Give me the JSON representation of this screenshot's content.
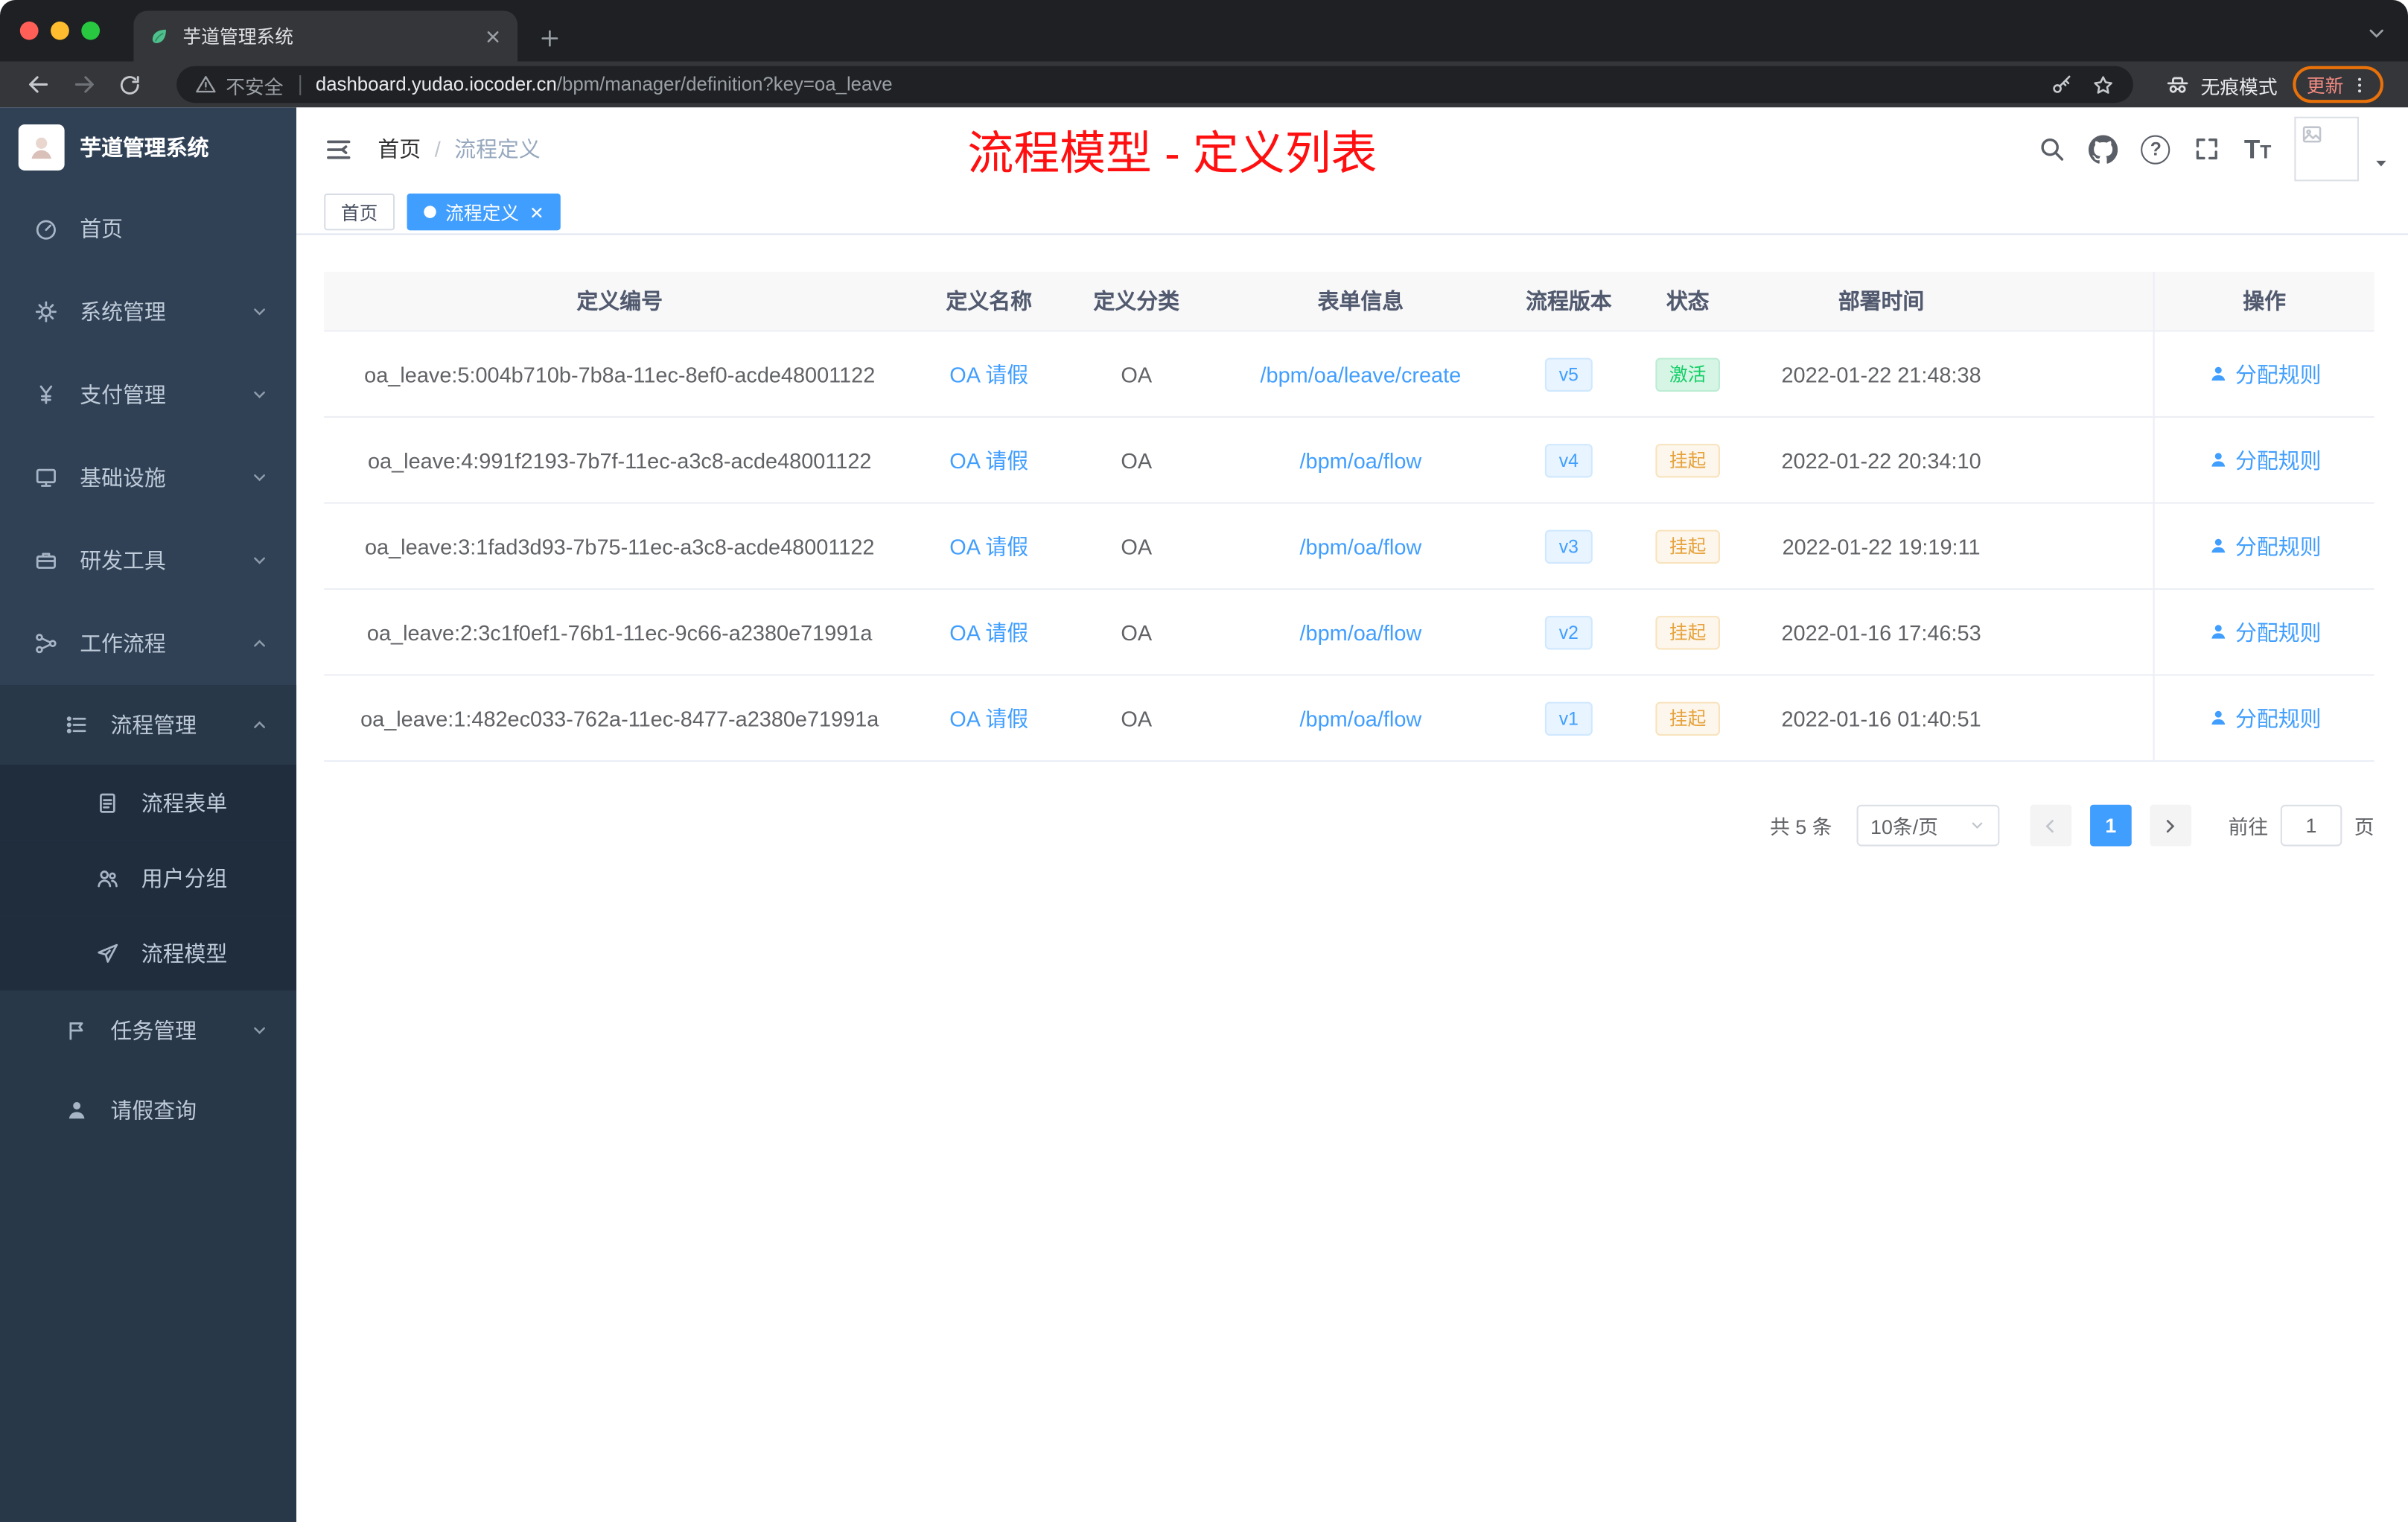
{
  "browser": {
    "tab_title": "芋道管理系统",
    "security_label": "不安全",
    "url_host": "dashboard.yudao.iocoder.cn",
    "url_path": "/bpm/manager/definition?key=oa_leave",
    "incognito_label": "无痕模式",
    "update_label": "更新"
  },
  "sidebar": {
    "app_title": "芋道管理系统",
    "items": [
      {
        "label": "首页"
      },
      {
        "label": "系统管理"
      },
      {
        "label": "支付管理"
      },
      {
        "label": "基础设施"
      },
      {
        "label": "研发工具"
      },
      {
        "label": "工作流程"
      },
      {
        "label": "流程管理"
      },
      {
        "label": "流程表单"
      },
      {
        "label": "用户分组"
      },
      {
        "label": "流程模型"
      },
      {
        "label": "任务管理"
      },
      {
        "label": "请假查询"
      }
    ]
  },
  "header": {
    "breadcrumb_home": "首页",
    "breadcrumb_sep": "/",
    "breadcrumb_current": "流程定义",
    "annotation": "流程模型 - 定义列表"
  },
  "tags": {
    "home": "首页",
    "active": "流程定义"
  },
  "icons": {
    "question": "?",
    "font_large": "T",
    "font_small": "T"
  },
  "table": {
    "columns": [
      "定义编号",
      "定义名称",
      "定义分类",
      "表单信息",
      "流程版本",
      "状态",
      "部署时间",
      "操作"
    ],
    "action_label": "分配规则",
    "rows": [
      {
        "id": "oa_leave:5:004b710b-7b8a-11ec-8ef0-acde48001122",
        "name": "OA 请假",
        "category": "OA",
        "form": "/bpm/oa/leave/create",
        "version": "v5",
        "status": "激活",
        "time": "2022-01-22 21:48:38"
      },
      {
        "id": "oa_leave:4:991f2193-7b7f-11ec-a3c8-acde48001122",
        "name": "OA 请假",
        "category": "OA",
        "form": "/bpm/oa/flow",
        "version": "v4",
        "status": "挂起",
        "time": "2022-01-22 20:34:10"
      },
      {
        "id": "oa_leave:3:1fad3d93-7b75-11ec-a3c8-acde48001122",
        "name": "OA 请假",
        "category": "OA",
        "form": "/bpm/oa/flow",
        "version": "v3",
        "status": "挂起",
        "time": "2022-01-22 19:19:11"
      },
      {
        "id": "oa_leave:2:3c1f0ef1-76b1-11ec-9c66-a2380e71991a",
        "name": "OA 请假",
        "category": "OA",
        "form": "/bpm/oa/flow",
        "version": "v2",
        "status": "挂起",
        "time": "2022-01-16 17:46:53"
      },
      {
        "id": "oa_leave:1:482ec033-762a-11ec-8477-a2380e71991a",
        "name": "OA 请假",
        "category": "OA",
        "form": "/bpm/oa/flow",
        "version": "v1",
        "status": "挂起",
        "time": "2022-01-16 01:40:51"
      }
    ]
  },
  "pagination": {
    "total": "共 5 条",
    "page_size": "10条/页",
    "page": "1",
    "goto": "前往",
    "unit": "页",
    "goto_value": "1"
  },
  "colors": {
    "accent": "#409eff",
    "annotation_red": "#ff0f0f",
    "success_green": "#13ce66",
    "warning_orange": "#e6a23c"
  }
}
